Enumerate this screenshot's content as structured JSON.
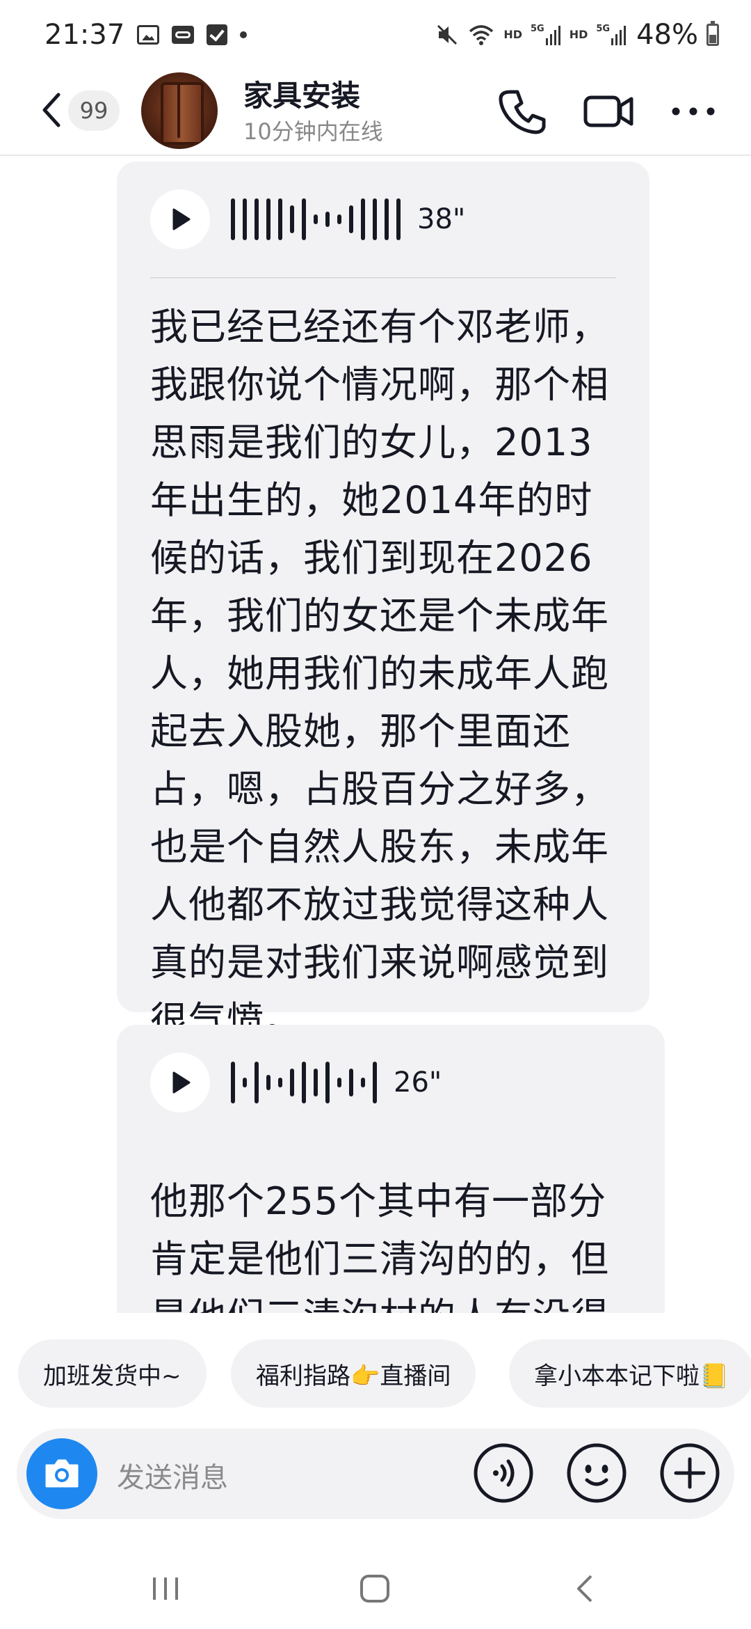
{
  "status_bar": {
    "time": "21:37",
    "network_1": "HD",
    "network_1_gen": "5G",
    "network_2": "HD",
    "network_2_gen": "5G",
    "battery": "48%",
    "battery_level": 0.48
  },
  "header": {
    "unread_count": "99",
    "contact_name": "家具安装",
    "contact_status": "10分钟内在线"
  },
  "messages": [
    {
      "duration": "38\"",
      "transcript": "我已经已经还有个邓老师，我跟你说个情况啊，那个相思雨是我们的女儿，2013年出生的，她2014年的时候的话，我们到现在2026年，我们的女还是个未成年人，她用我们的未成年人跑起去入股她，那个里面还占，嗯，占股百分之好多，也是个自然人股东，未成年人他都不放过我觉得这种人真的是对我们来说啊感觉到很气愤。"
    },
    {
      "duration": "26\"",
      "transcript": "他那个255个其中有一部分肯定是他们三清沟的的，但是他们三清沟村的人有没得开"
    }
  ],
  "quick_replies": [
    "加班发货中~",
    "福利指路👉直播间",
    "拿小本本记下啦📒"
  ],
  "input": {
    "placeholder": "发送消息"
  },
  "icons": {
    "back": "chevron-left-icon",
    "phone": "phone-icon",
    "video": "video-camera-icon",
    "more": "more-dots-icon",
    "camera": "camera-icon",
    "voice": "voice-input-icon",
    "emoji": "emoji-icon",
    "plus": "plus-icon"
  },
  "colors": {
    "accent": "#1e88f0",
    "bubble": "#f2f2f4",
    "text": "#161823"
  }
}
